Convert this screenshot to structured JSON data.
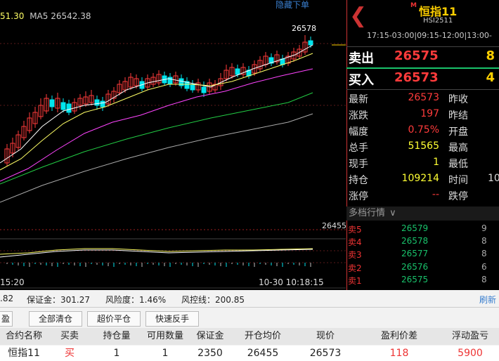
{
  "chart": {
    "ma_partial": "51.30",
    "ma5_label": "MA5 26542.38",
    "hide_link": "隐藏下单",
    "peak_label": "26578",
    "price_marker": "26455",
    "time_left": "15:20",
    "time_right": "10-30 10:18:15",
    "colors": {
      "up": "#ff3b3b",
      "down": "#00e5ee",
      "ma5": "#ffffff",
      "ma10": "#ffff66",
      "ma20": "#ff44ff",
      "ma40": "#22cc44",
      "ma60": "#aaaaaa"
    }
  },
  "panel": {
    "back_icon": "chevron-left-icon",
    "contract_marker": "M",
    "contract_name": "恒指11",
    "contract_code": "HSI2511",
    "sessions": "17:15-03:00|09:15-12:00|13:00-",
    "sell": {
      "label": "卖出",
      "price": "26575",
      "volume": "8"
    },
    "buy": {
      "label": "买入",
      "price": "26573",
      "volume": "4"
    },
    "quote_left": [
      {
        "label": "最新",
        "value": "26573"
      },
      {
        "label": "涨跌",
        "value": "197"
      },
      {
        "label": "幅度",
        "value": "0.75%"
      },
      {
        "label": "总手",
        "value": "51565"
      },
      {
        "label": "现手",
        "value": "1"
      },
      {
        "label": "持仓",
        "value": "109214"
      },
      {
        "label": "涨停",
        "value": "--"
      }
    ],
    "quote_right": [
      {
        "label": "昨收",
        "value": ""
      },
      {
        "label": "昨结",
        "value": ""
      },
      {
        "label": "开盘",
        "value": ""
      },
      {
        "label": "最高",
        "value": ""
      },
      {
        "label": "最低",
        "value": ""
      },
      {
        "label": "时间",
        "value": "10"
      },
      {
        "label": "跌停",
        "value": ""
      }
    ],
    "depth_header": "多档行情",
    "depth": [
      {
        "label": "卖5",
        "price": "26579",
        "volume": "9"
      },
      {
        "label": "卖4",
        "price": "26578",
        "volume": "8"
      },
      {
        "label": "卖3",
        "price": "26577",
        "volume": "8"
      },
      {
        "label": "卖2",
        "price": "26576",
        "volume": "6"
      },
      {
        "label": "卖1",
        "price": "26575",
        "volume": "8"
      }
    ]
  },
  "account": {
    "partial": ".82",
    "margin": "保证金：301.27",
    "risk": "风险度：1.46%",
    "risk_line": "风控线：200.85",
    "refresh": "刷新"
  },
  "buttons": {
    "close_partial": "盈",
    "close_all": "全部清仓",
    "smart_close": "超价平仓",
    "reverse": "快速反手"
  },
  "table": {
    "headers": [
      "合约名称",
      "买卖",
      "持仓量",
      "可用数量",
      "保证金",
      "开仓均价",
      "现价",
      "盈利价差",
      "浮动盈亏"
    ],
    "row": [
      "恒指11",
      "买",
      "1",
      "1",
      "2350",
      "26455",
      "26573",
      "118",
      "5900"
    ]
  }
}
